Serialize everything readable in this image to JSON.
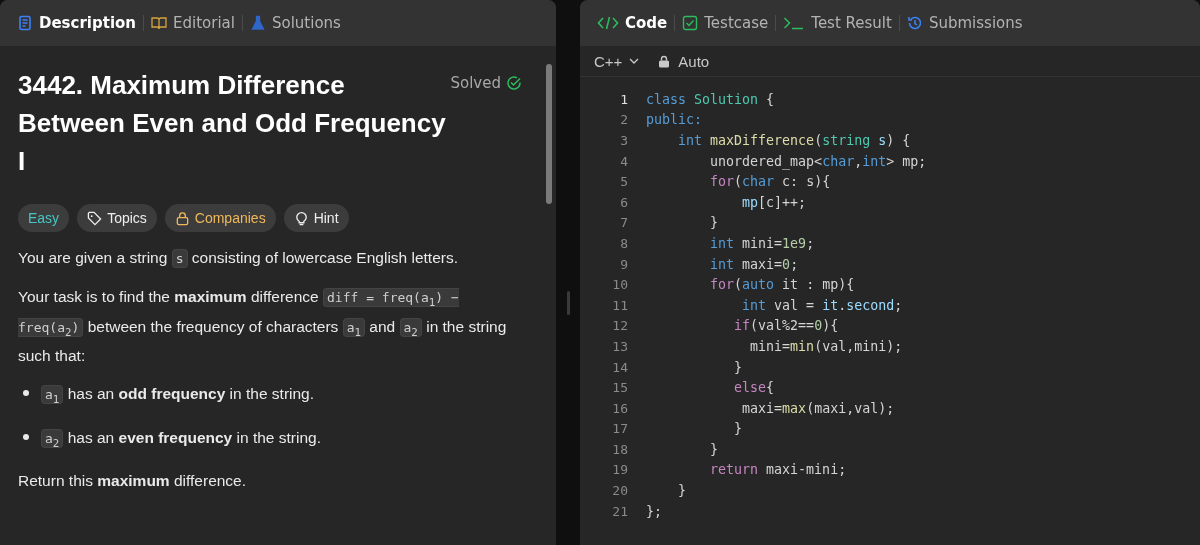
{
  "left_tabs": [
    {
      "label": "Description",
      "selected": true
    },
    {
      "label": "Editorial",
      "selected": false
    },
    {
      "label": "Solutions",
      "selected": false
    }
  ],
  "problem": {
    "title": "3442. Maximum Difference Between Even and Odd Frequency I",
    "status": "Solved",
    "solved": true,
    "tags": [
      {
        "label": "Easy",
        "kind": "difficulty"
      },
      {
        "label": "Topics",
        "kind": "tag"
      },
      {
        "label": "Companies",
        "kind": "lock"
      },
      {
        "label": "Hint",
        "kind": "bulb"
      }
    ],
    "body": [
      {
        "kind": "paragraph",
        "parts": [
          {
            "kind": "text",
            "text": "You are given a string "
          },
          {
            "kind": "code",
            "text": "s"
          },
          {
            "kind": "text",
            "text": " consisting of lowercase English letters."
          }
        ]
      },
      {
        "kind": "paragraph",
        "parts": [
          {
            "kind": "text",
            "text": "Your task is to find the **maximum** difference "
          },
          {
            "kind": "code",
            "text": "diff = freq(a$_{1}$) − freq(a$_{2}$)"
          },
          {
            "kind": "text",
            "text": " between the frequency of characters "
          },
          {
            "kind": "code",
            "text": "a$_{1}$"
          },
          {
            "kind": "text",
            "text": " and "
          },
          {
            "kind": "code",
            "text": "a$_{2}$"
          },
          {
            "kind": "text",
            "text": " in the string such that:"
          }
        ]
      },
      {
        "kind": "bullet",
        "parts": [
          {
            "kind": "code",
            "text": "a$_{1}$"
          },
          {
            "kind": "text",
            "text": " has an **odd frequency** in the string."
          }
        ]
      },
      {
        "kind": "bullet",
        "parts": [
          {
            "kind": "code",
            "text": "a$_{2}$"
          },
          {
            "kind": "text",
            "text": " has an **even frequency** in the string."
          }
        ]
      },
      {
        "kind": "paragraph",
        "parts": [
          {
            "kind": "text",
            "text": "Return this **maximum** difference."
          }
        ]
      }
    ]
  },
  "right_tabs": [
    {
      "label": "Code",
      "selected": true
    },
    {
      "label": "Testcase",
      "selected": false
    },
    {
      "label": "Test Result",
      "selected": false
    },
    {
      "label": "Submissions",
      "selected": false
    }
  ],
  "editor": {
    "language": "C++",
    "mode": "Auto",
    "lines": [
      {
        "number": "1",
        "tokens": [
          {
            "color": "#569cd6",
            "text": "class"
          },
          {
            "color": "#4ec9b0",
            "text": " Solution"
          },
          {
            "text": " {"
          }
        ]
      },
      {
        "number": "2",
        "tokens": [
          {
            "color": "#569cd6",
            "text": "public:"
          }
        ]
      },
      {
        "number": "3",
        "tokens": [
          {
            "color": "#569cd6",
            "text": "    int"
          },
          {
            "color": "#dcdcaa",
            "text": " maxDifference"
          },
          {
            "text": "("
          },
          {
            "color": "#4ec9b0",
            "text": "string"
          },
          {
            "color": "#9cdcfe",
            "text": " s"
          },
          {
            "text": ") {"
          }
        ]
      },
      {
        "number": "4",
        "tokens": [
          {
            "text": "        unordered_map<"
          },
          {
            "color": "#569cd6",
            "text": "char"
          },
          {
            "text": ","
          },
          {
            "color": "#569cd6",
            "text": "int"
          },
          {
            "text": "> mp;"
          }
        ]
      },
      {
        "number": "5",
        "tokens": [
          {
            "color": "#c586c0",
            "text": "        for"
          },
          {
            "text": "("
          },
          {
            "color": "#569cd6",
            "text": "char"
          },
          {
            "text": " c: s){"
          }
        ]
      },
      {
        "number": "6",
        "tokens": [
          {
            "color": "#9cdcfe",
            "text": "            mp"
          },
          {
            "text": "[c]++;"
          }
        ]
      },
      {
        "number": "7",
        "tokens": [
          {
            "text": "        }"
          }
        ]
      },
      {
        "number": "8",
        "tokens": [
          {
            "color": "#569cd6",
            "text": "        int"
          },
          {
            "text": " mini="
          },
          {
            "color": "#b5cea8",
            "text": "1e9"
          },
          {
            "text": ";"
          }
        ]
      },
      {
        "number": "9",
        "tokens": [
          {
            "color": "#569cd6",
            "text": "        int"
          },
          {
            "text": " maxi="
          },
          {
            "color": "#b5cea8",
            "text": "0"
          },
          {
            "text": ";"
          }
        ]
      },
      {
        "number": "10",
        "tokens": [
          {
            "color": "#c586c0",
            "text": "        for"
          },
          {
            "text": "("
          },
          {
            "color": "#569cd6",
            "text": "auto"
          },
          {
            "text": " it : mp){"
          }
        ]
      },
      {
        "number": "11",
        "tokens": [
          {
            "color": "#569cd6",
            "text": "            int"
          },
          {
            "text": " val = "
          },
          {
            "color": "#9cdcfe",
            "text": "it"
          },
          {
            "text": "."
          },
          {
            "color": "#9cdcfe",
            "text": "second"
          },
          {
            "text": ";"
          }
        ]
      },
      {
        "number": "12",
        "tokens": [
          {
            "color": "#c586c0",
            "text": "           if"
          },
          {
            "text": "(val%2=="
          },
          {
            "color": "#b5cea8",
            "text": "0"
          },
          {
            "text": "){"
          }
        ]
      },
      {
        "number": "13",
        "tokens": [
          {
            "text": "             mini="
          },
          {
            "color": "#dcdcaa",
            "text": "min"
          },
          {
            "text": "(val,mini);"
          }
        ]
      },
      {
        "number": "14",
        "tokens": [
          {
            "text": "           }"
          }
        ]
      },
      {
        "number": "15",
        "tokens": [
          {
            "color": "#c586c0",
            "text": "           else"
          },
          {
            "text": "{"
          }
        ]
      },
      {
        "number": "16",
        "tokens": [
          {
            "text": "            maxi="
          },
          {
            "color": "#dcdcaa",
            "text": "max"
          },
          {
            "text": "(maxi,val);"
          }
        ]
      },
      {
        "number": "17",
        "tokens": [
          {
            "text": "           }"
          }
        ]
      },
      {
        "number": "18",
        "tokens": [
          {
            "text": "        }"
          }
        ]
      },
      {
        "number": "19",
        "tokens": [
          {
            "color": "#c586c0",
            "text": "        return"
          },
          {
            "text": " maxi-mini;"
          }
        ]
      },
      {
        "number": "20",
        "tokens": [
          {
            "text": "    }"
          }
        ]
      },
      {
        "number": "21",
        "tokens": [
          {
            "text": "};"
          }
        ]
      }
    ]
  }
}
